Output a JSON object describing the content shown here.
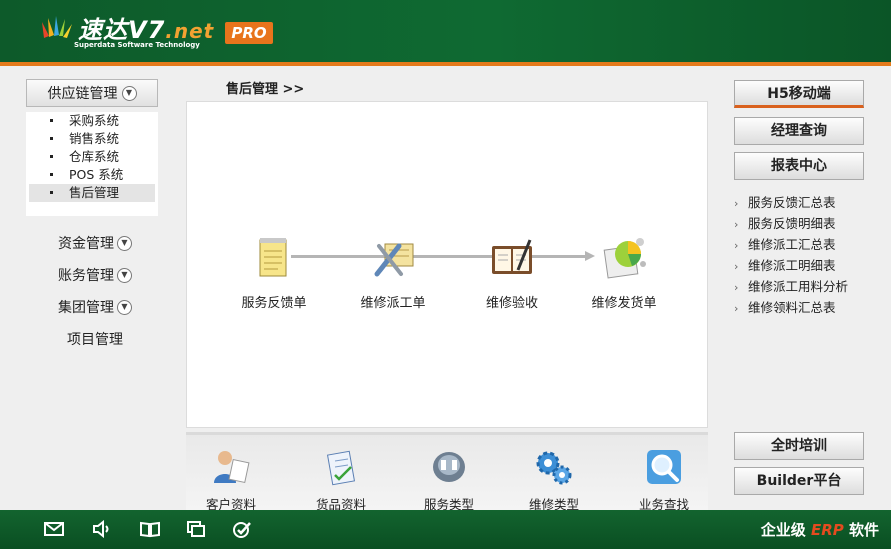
{
  "header": {
    "logo_name": "速达V7",
    "logo_net": ".net",
    "logo_sub": "Superdata Software Technology",
    "badge": "PRO"
  },
  "left_sidebar": {
    "supply_chain": {
      "label": "供应链管理",
      "expanded": true
    },
    "supply_items": [
      "采购系统",
      "销售系统",
      "仓库系统",
      "POS 系统",
      "售后管理"
    ],
    "active_item": "售后管理",
    "groups": [
      "资金管理",
      "账务管理",
      "集团管理"
    ],
    "project": "项目管理"
  },
  "breadcrumb": "售后管理 >>",
  "workflow": {
    "steps": [
      {
        "label": "服务反馈单",
        "icon": "notepad-icon"
      },
      {
        "label": "维修派工单",
        "icon": "tools-icon"
      },
      {
        "label": "维修验收",
        "icon": "notebook-icon"
      },
      {
        "label": "维修发货单",
        "icon": "pie-chart-icon"
      }
    ]
  },
  "toolbar": {
    "items": [
      {
        "label": "客户资料",
        "icon": "customer-icon"
      },
      {
        "label": "货品资料",
        "icon": "clipboard-icon"
      },
      {
        "label": "服务类型",
        "icon": "service-icon"
      },
      {
        "label": "维修类型",
        "icon": "gears-icon"
      },
      {
        "label": "业务查找",
        "icon": "magnifier-icon"
      }
    ]
  },
  "right": {
    "h5": "H5移动端",
    "manager": "经理查询",
    "report_center": "报表中心",
    "reports": [
      "服务反馈汇总表",
      "服务反馈明细表",
      "维修派工汇总表",
      "维修派工明细表",
      "维修派工用料分析",
      "维修领料汇总表"
    ],
    "training": "全时培训",
    "builder": "Builder平台"
  },
  "footer": {
    "prefix": "企业级",
    "erp": "ERP",
    "suffix": "软件",
    "icons": [
      "mail-icon",
      "speaker-icon",
      "book-icon",
      "window-icon",
      "check-icon"
    ]
  },
  "colors": {
    "header_green": "#0f6a32",
    "accent_orange": "#e47a1b",
    "erp_red": "#e44b1f"
  }
}
